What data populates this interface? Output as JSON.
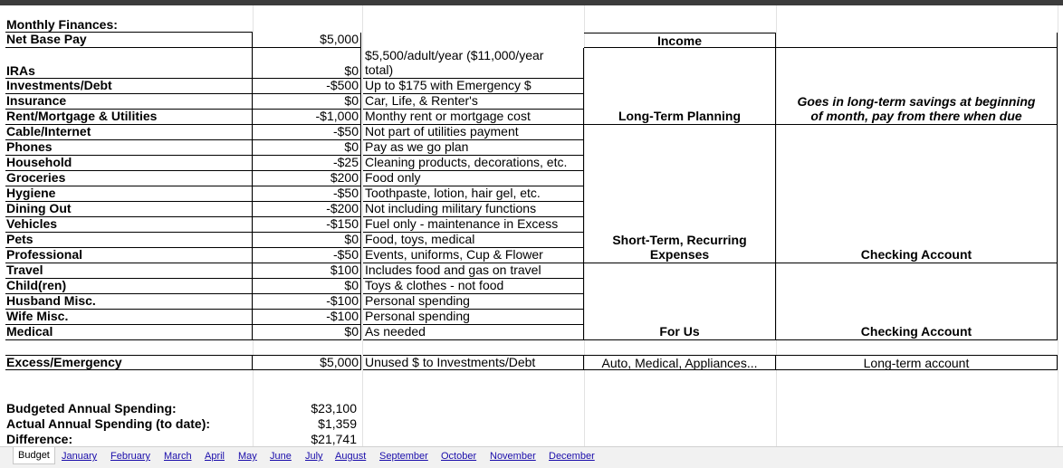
{
  "header": {
    "title": "Monthly Finances:"
  },
  "net_pay": {
    "label": "Net Base Pay",
    "value": "$5,000"
  },
  "budget_rows": [
    {
      "label": "IRAs",
      "amount": "$0",
      "note": "$5,500/adult/year ($11,000/year",
      "note_cont": "total)"
    },
    {
      "label": "Investments/Debt",
      "amount": "-$500",
      "note": "Up to $175 with Emergency $"
    },
    {
      "label": "Insurance",
      "amount": "$0",
      "note": "Car, Life, & Renter's"
    },
    {
      "label": "Rent/Mortgage & Utilities",
      "amount": "-$1,000",
      "note": "Monthy rent or mortgage cost"
    },
    {
      "label": "Cable/Internet",
      "amount": "-$50",
      "note": "Not part of utilities payment"
    },
    {
      "label": "Phones",
      "amount": "$0",
      "note": "Pay as we go plan"
    },
    {
      "label": "Household",
      "amount": "-$25",
      "note": "Cleaning products, decorations, etc."
    },
    {
      "label": "Groceries",
      "amount": "$200",
      "note": "Food only"
    },
    {
      "label": "Hygiene",
      "amount": "-$50",
      "note": "Toothpaste, lotion, hair gel, etc."
    },
    {
      "label": "Dining Out",
      "amount": "-$200",
      "note": "Not including military functions"
    },
    {
      "label": "Vehicles",
      "amount": "-$150",
      "note": "Fuel only - maintenance in Excess"
    },
    {
      "label": "Pets",
      "amount": "$0",
      "note": "Food, toys, medical"
    },
    {
      "label": "Professional",
      "amount": "-$50",
      "note": "Events, uniforms, Cup & Flower"
    },
    {
      "label": "Travel",
      "amount": "$100",
      "note": "Includes food and gas on travel"
    },
    {
      "label": "Child(ren)",
      "amount": "$0",
      "note": "Toys & clothes - not food"
    },
    {
      "label": "Husband Misc.",
      "amount": "-$100",
      "note": "Personal spending"
    },
    {
      "label": "Wife Misc.",
      "amount": "-$100",
      "note": "Personal spending"
    },
    {
      "label": "Medical",
      "amount": "$0",
      "note": "As needed"
    }
  ],
  "excess": {
    "label": "Excess/Emergency",
    "amount": "$5,000",
    "note": "Unused $ to Investments/Debt",
    "category": "Auto, Medical, Appliances...",
    "account": "Long-term account"
  },
  "categories": {
    "income": "Income",
    "long_term": "Long-Term Planning",
    "long_term_note": "Goes in long-term savings at beginning of month, pay from there when due",
    "short_term": "Short-Term, Recurring Expenses",
    "short_term_account": "Checking Account",
    "for_us": "For Us",
    "for_us_account": "Checking Account"
  },
  "summary": [
    {
      "label": "Budgeted Annual Spending:",
      "value": "$23,100"
    },
    {
      "label": "Actual Annual Spending (to date):",
      "value": "$1,359"
    },
    {
      "label": "Difference:",
      "value": "$21,741"
    }
  ],
  "sheet_tabs": {
    "active": "Budget",
    "months": [
      "January",
      "February",
      "March",
      "April",
      "May",
      "June",
      "July",
      "August",
      "September",
      "October",
      "November",
      "December"
    ]
  }
}
